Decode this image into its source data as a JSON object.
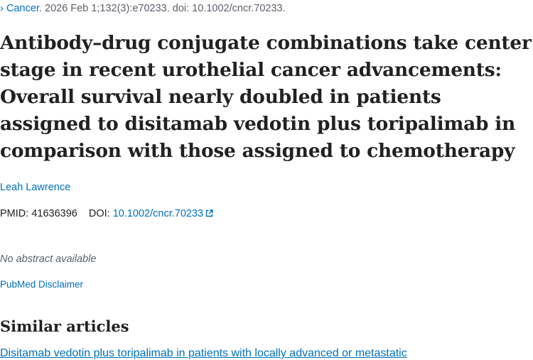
{
  "citation": {
    "chevron": "›",
    "journal": "Cancer.",
    "details": "2026 Feb 1;132(3):e70233. doi: 10.1002/cncr.70233."
  },
  "title": "Antibody–drug conjugate combinations take center stage in recent urothelial cancer advancements: Overall survival nearly doubled in patients assigned to disitamab vedotin plus toripalimab in comparison with those assigned to chemotherapy",
  "author": "Leah Lawrence",
  "ids": {
    "pmid_label": "PMID:",
    "pmid": "41636396",
    "doi_label": "DOI:",
    "doi": "10.1002/cncr.70233"
  },
  "abstract_note": "No abstract available",
  "disclaimer": "PubMed Disclaimer",
  "similar": {
    "heading": "Similar articles",
    "first_article": "Disitamab vedotin plus toripalimab in patients with locally advanced or metastatic"
  },
  "icons": {
    "external_link": "external-link-icon"
  },
  "colors": {
    "link": "#0071bc",
    "text": "#212121",
    "muted": "#5b616b"
  }
}
